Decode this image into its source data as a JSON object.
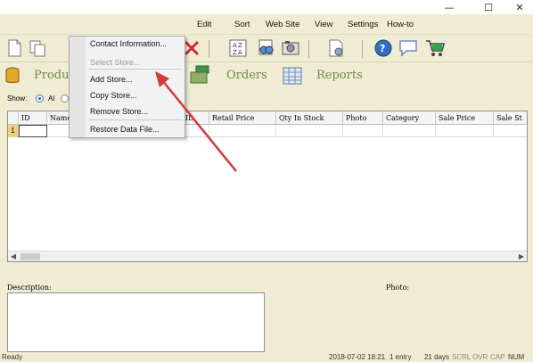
{
  "window": {
    "minimize_glyph": "—",
    "maximize_glyph": "☐",
    "close_glyph": "✕"
  },
  "menu": {
    "items": [
      "Edit",
      "Sort",
      "Web Site",
      "View",
      "Settings",
      "How-to"
    ]
  },
  "toolbar": {
    "icons": [
      "new-document-icon",
      "copy-icon",
      "delete-icon",
      "sort-az-icon",
      "find-icon",
      "camera-icon",
      "upload-icon",
      "help-icon",
      "chat-icon",
      "cart-icon"
    ]
  },
  "nav": {
    "products_label": "Produ",
    "orders_label": "Orders",
    "reports_label": "Reports"
  },
  "show": {
    "label": "Show:",
    "all_option": "Al"
  },
  "grid": {
    "columns": [
      "ID",
      "Name",
      "ID",
      "Retail Price",
      "Qty In Stock",
      "Photo",
      "Category",
      "Sale Price",
      "Sale St"
    ],
    "row_number": "1"
  },
  "description": {
    "label": "Description:"
  },
  "photo": {
    "label": "Photo:"
  },
  "status": {
    "ready": "Ready",
    "datetime": "2018-07-02 18:21",
    "entries": "1 entry",
    "days": "21 days",
    "indicators": [
      "SCRL",
      "OVR",
      "CAP",
      "NUM"
    ]
  },
  "dropdown": {
    "items": [
      {
        "label": "Contact Information...",
        "enabled": true
      },
      {
        "label": "Select Store...",
        "enabled": false
      },
      {
        "label": "Add Store...",
        "enabled": true
      },
      {
        "label": "Copy Store...",
        "enabled": true
      },
      {
        "label": "Remove Store...",
        "enabled": true
      },
      {
        "label": "Restore Data File...",
        "enabled": true
      }
    ]
  },
  "colors": {
    "background": "#f0ecd3",
    "nav_text": "#6b8a4a",
    "annotation_arrow": "#d33a3a",
    "row_header": "#f0d07a"
  }
}
